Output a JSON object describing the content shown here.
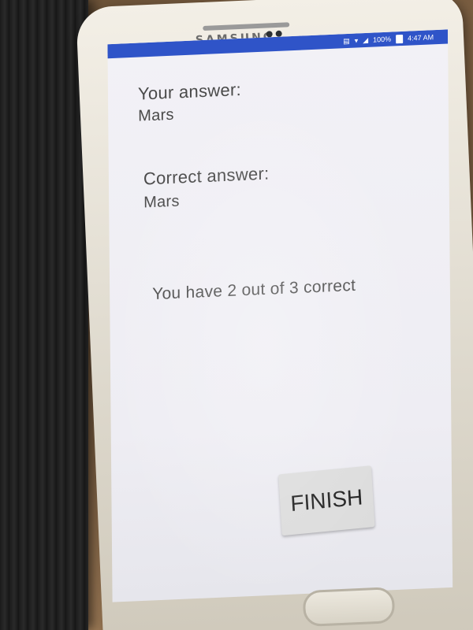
{
  "device": {
    "brand": "SAMSUNG"
  },
  "status_bar": {
    "battery_text": "100%",
    "time": "4:47 AM",
    "color": "#2f54c8"
  },
  "result": {
    "your_answer_label": "Your answer:",
    "your_answer_value": "Mars",
    "correct_answer_label": "Correct answer:",
    "correct_answer_value": "Mars",
    "score_text": "You have 2 out of 3 correct"
  },
  "actions": {
    "finish_label": "FINISH"
  }
}
